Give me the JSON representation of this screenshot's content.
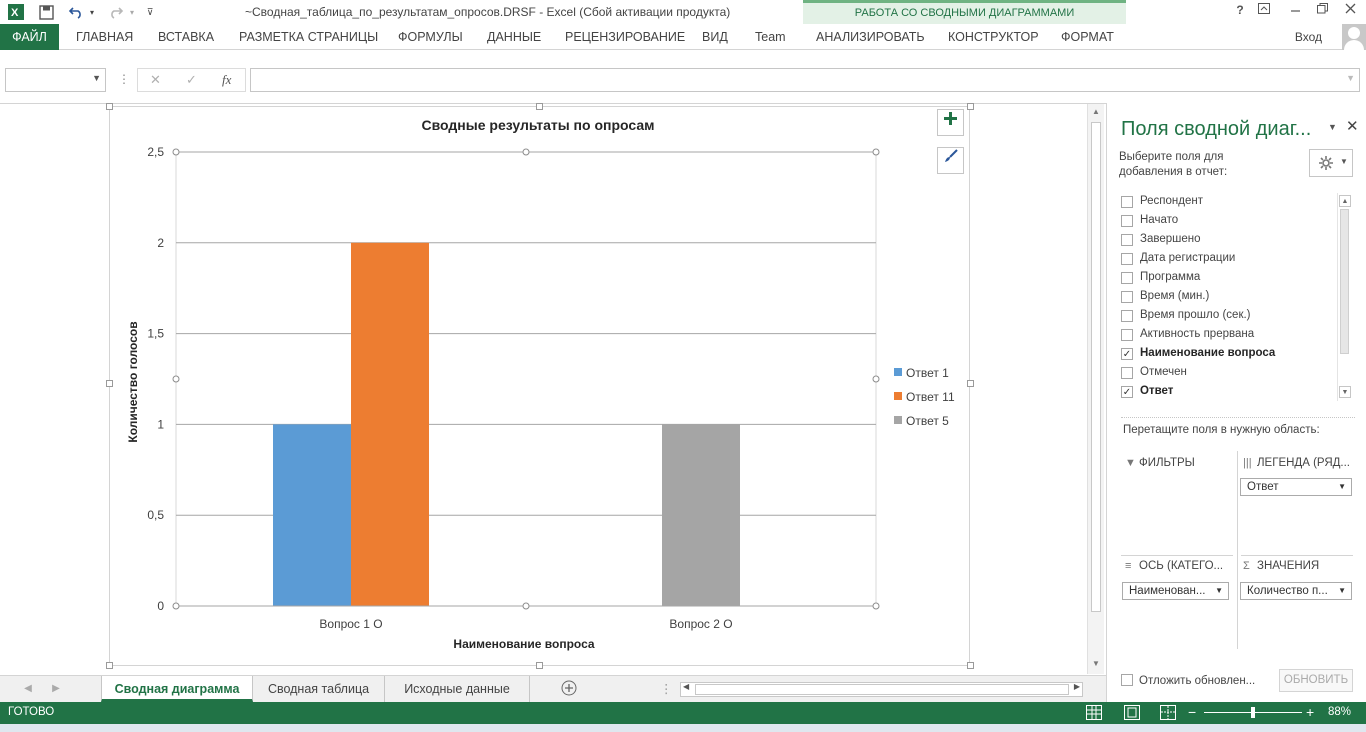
{
  "window": {
    "title": "~Сводная_таблица_по_результатам_опросов.DRSF - Excel (Сбой активации продукта)",
    "context_header": "РАБОТА СО СВОДНЫМИ ДИАГРАММАМИ",
    "help": "?",
    "sign_in": "Вход"
  },
  "ribbon": {
    "tabs": [
      "ФАЙЛ",
      "ГЛАВНАЯ",
      "ВСТАВКА",
      "РАЗМЕТКА СТРАНИЦЫ",
      "ФОРМУЛЫ",
      "ДАННЫЕ",
      "РЕЦЕНЗИРОВАНИЕ",
      "ВИД",
      "Team",
      "АНАЛИЗИРОВАТЬ",
      "КОНСТРУКТОР",
      "ФОРМАТ"
    ]
  },
  "formula_bar": {
    "name_box": "",
    "fx": "fx",
    "formula": ""
  },
  "chart_data": {
    "type": "bar",
    "title": "Сводные результаты по опросам",
    "xlabel": "Наименование вопроса",
    "ylabel": "Количество голосов",
    "categories": [
      "Вопрос 1 О",
      "Вопрос 2 О"
    ],
    "series": [
      {
        "name": "Ответ 1",
        "color": "#5b9bd5",
        "values": [
          1,
          0
        ]
      },
      {
        "name": "Ответ 11",
        "color": "#ed7d31",
        "values": [
          2,
          0
        ]
      },
      {
        "name": "Ответ 5",
        "color": "#a5a5a5",
        "values": [
          0,
          1
        ]
      }
    ],
    "ylim": [
      0,
      2.5
    ],
    "yticks": [
      "0",
      "0,5",
      "1",
      "1,5",
      "2",
      "2,5"
    ],
    "grid": true,
    "legend": "right"
  },
  "chart_buttons": {
    "add_element": "+",
    "styles": "brush"
  },
  "sheets": {
    "tabs": [
      "Сводная диаграмма",
      "Сводная таблица",
      "Исходные данные"
    ],
    "active": "Сводная диаграмма"
  },
  "pivot_panel": {
    "title": "Поля сводной диаг...",
    "hint": "Выберите поля для добавления в отчет:",
    "fields": [
      {
        "label": "Респондент",
        "checked": false
      },
      {
        "label": "Начато",
        "checked": false
      },
      {
        "label": "Завершено",
        "checked": false
      },
      {
        "label": "Дата регистрации",
        "checked": false
      },
      {
        "label": "Программа",
        "checked": false
      },
      {
        "label": "Время (мин.)",
        "checked": false
      },
      {
        "label": "Время прошло (сек.)",
        "checked": false
      },
      {
        "label": "Активность прервана",
        "checked": false
      },
      {
        "label": "Наименование вопроса",
        "checked": true
      },
      {
        "label": "Отмечен",
        "checked": false
      },
      {
        "label": "Ответ",
        "checked": true
      }
    ],
    "drag_hint": "Перетащите поля в нужную область:",
    "areas": {
      "filters": {
        "title": "ФИЛЬТРЫ"
      },
      "legend": {
        "title": "ЛЕГЕНДА (РЯД...",
        "value": "Ответ"
      },
      "axis": {
        "title": "ОСЬ (КАТЕГО...",
        "value": "Наименован..."
      },
      "values": {
        "title": "ЗНАЧЕНИЯ",
        "value": "Количество п..."
      }
    },
    "defer_label": "Отложить обновлен...",
    "update_button": "ОБНОВИТЬ"
  },
  "status": {
    "text": "ГОТОВО",
    "zoom": "88%",
    "zoom_fraction": 0.5
  }
}
